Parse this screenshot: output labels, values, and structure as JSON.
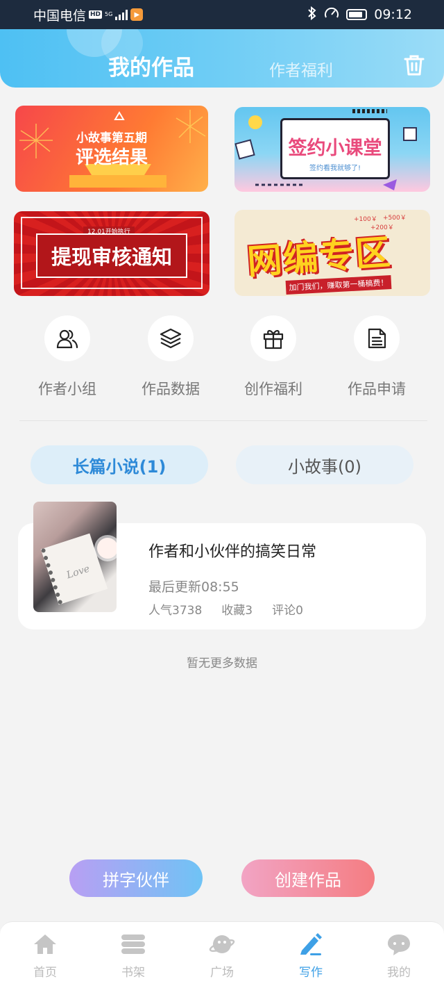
{
  "status_bar": {
    "carrier": "中国电信",
    "hd": "HD",
    "network": "5G",
    "time": "09:12"
  },
  "header": {
    "tabs": [
      {
        "label": "我的作品",
        "active": true
      },
      {
        "label": "作者福利",
        "active": false
      }
    ],
    "trash_icon": "trash-icon"
  },
  "banners": [
    {
      "line1": "小故事第五期",
      "line2": "评选结果"
    },
    {
      "title": "签约小课堂",
      "subtitle": "签约看我就够了!"
    },
    {
      "title": "提现审核通知",
      "tag": "12.01开始执行"
    },
    {
      "title": "网编专区",
      "strip": "加门我们，赚取第一桶稿费！",
      "deco1": "+100￥",
      "deco2": "+500￥",
      "deco3": "+200￥"
    }
  ],
  "quick_actions": [
    {
      "label": "作者小组",
      "icon": "users-icon"
    },
    {
      "label": "作品数据",
      "icon": "layers-icon"
    },
    {
      "label": "创作福利",
      "icon": "gift-icon"
    },
    {
      "label": "作品申请",
      "icon": "document-icon"
    }
  ],
  "categories": [
    {
      "label": "长篇小说(1)",
      "active": true
    },
    {
      "label": "小故事(0)",
      "active": false
    }
  ],
  "work": {
    "title": "作者和小伙伴的搞笑日常",
    "updated": "最后更新08:55",
    "popularity": "人气3738",
    "favorites": "收藏3",
    "comments": "评论0",
    "cover_text": "Love"
  },
  "no_more_text": "暂无更多数据",
  "buttons": {
    "partner": "拼字伙伴",
    "create": "创建作品"
  },
  "tabbar": [
    {
      "label": "首页",
      "icon": "home-icon",
      "active": false
    },
    {
      "label": "书架",
      "icon": "bookshelf-icon",
      "active": false
    },
    {
      "label": "广场",
      "icon": "planet-icon",
      "active": false
    },
    {
      "label": "写作",
      "icon": "pen-icon",
      "active": true
    },
    {
      "label": "我的",
      "icon": "chat-bubble-icon",
      "active": false
    }
  ],
  "colors": {
    "accent": "#3ea0e6",
    "header_gradient_start": "#4ec0f3",
    "create_gradient_end": "#f47d82",
    "partner_gradient_start": "#b89ff3"
  }
}
